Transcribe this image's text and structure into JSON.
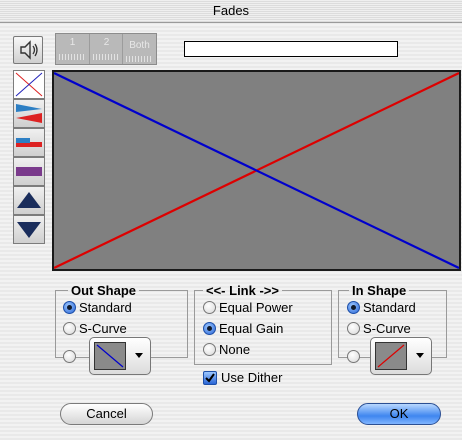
{
  "window": {
    "title": "Fades"
  },
  "toolbar": {
    "channels": [
      {
        "label": "1"
      },
      {
        "label": "2"
      },
      {
        "label": "Both"
      }
    ]
  },
  "fade_lines": {
    "out_color": "#0000cc",
    "in_color": "#dd0000"
  },
  "out_shape": {
    "title": "Out Shape",
    "options": [
      "Standard",
      "S-Curve"
    ],
    "selected": "Standard"
  },
  "link": {
    "title": "<<- Link ->>",
    "options": [
      "Equal Power",
      "Equal Gain",
      "None"
    ],
    "selected": "Equal Gain",
    "dither_label": "Use Dither",
    "dither_checked": true
  },
  "in_shape": {
    "title": "In Shape",
    "options": [
      "Standard",
      "S-Curve"
    ],
    "selected": "Standard"
  },
  "buttons": {
    "cancel": "Cancel",
    "ok": "OK"
  }
}
